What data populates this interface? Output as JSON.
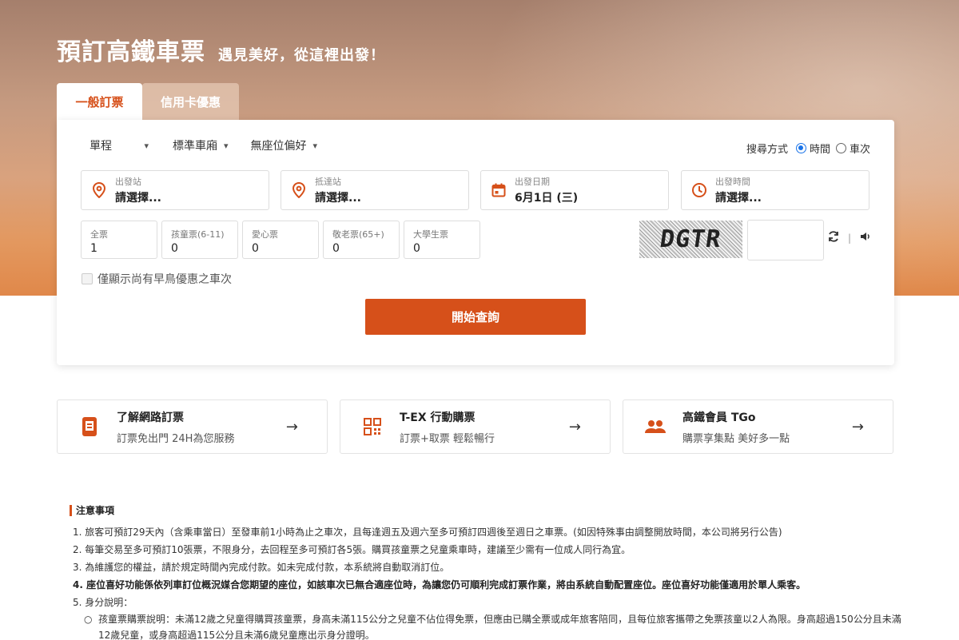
{
  "hero": {
    "title": "預訂高鐵車票",
    "subtitle": "遇見美好，從這裡出發！"
  },
  "tabs": [
    {
      "label": "一般訂票",
      "active": true
    },
    {
      "label": "信用卡優惠",
      "active": false
    }
  ],
  "options": {
    "trip_type": "單程",
    "car_type": "標準車廂",
    "seat_pref": "無座位偏好",
    "search_mode_label": "搜尋方式",
    "search_mode_time": "時間",
    "search_mode_train": "車次",
    "search_mode_selected": "時間"
  },
  "fields": {
    "departure": {
      "label": "出發站",
      "value": "請選擇...",
      "icon": "location-pin-icon"
    },
    "arrival": {
      "label": "抵達站",
      "value": "請選擇...",
      "icon": "location-pin-icon"
    },
    "date": {
      "label": "出發日期",
      "value": "6月1日 (三)",
      "icon": "calendar-icon"
    },
    "time": {
      "label": "出發時間",
      "value": "請選擇...",
      "icon": "clock-icon"
    }
  },
  "tickets": [
    {
      "label": "全票",
      "value": "1"
    },
    {
      "label": "孩童票(6-11)",
      "value": "0"
    },
    {
      "label": "愛心票",
      "value": "0"
    },
    {
      "label": "敬老票(65+)",
      "value": "0"
    },
    {
      "label": "大學生票",
      "value": "0"
    }
  ],
  "captcha": {
    "text": "DGTR",
    "input_value": ""
  },
  "early_bird_label": "僅顯示尚有早鳥優惠之車次",
  "search_button": "開始查詢",
  "info_cards": [
    {
      "title": "了解網路訂票",
      "sub": "訂票免出門 24H為您服務",
      "icon": "mobile-ticket-icon"
    },
    {
      "title": "T-EX 行動購票",
      "sub": "訂票+取票 輕鬆暢行",
      "icon": "qr-code-icon"
    },
    {
      "title": "高鐵會員 TGo",
      "sub": "購票享集點 美好多一點",
      "icon": "members-icon"
    }
  ],
  "notice": {
    "title": "注意事項",
    "items": [
      "1. 旅客可預訂29天內（含乘車當日）至發車前1小時為止之車次，且每逢週五及週六至多可預訂四週後至週日之車票。(如因特殊事由調整開放時間，本公司將另行公告)",
      "2. 每筆交易至多可預訂10張票，不限身分，去回程至多可預訂各5張。購買孩童票之兒童乘車時，建議至少需有一位成人同行為宜。",
      "3. 為維護您的權益，請於規定時間內完成付款。如未完成付款，本系統將自動取消訂位。",
      "4. 座位喜好功能係依列車訂位概況媒合您期望的座位，如該車次已無合適座位時，為讓您仍可順利完成訂票作業，將由系統自動配置座位。座位喜好功能僅適用於單人乘客。",
      "5. 身分說明："
    ],
    "subitem": "孩童票購票說明：未滿12歲之兒童得購買孩童票，身高未滿115公分之兒童不佔位得免票，但應由已購全票或成年旅客陪同，且每位旅客攜帶之免票孩童以2人為限。身高超過150公分且未滿12歲兒童，或身高超過115公分且未滿6歲兒童應出示身分證明。"
  },
  "colors": {
    "accent": "#d6501a",
    "radio": "#1a73e8"
  }
}
